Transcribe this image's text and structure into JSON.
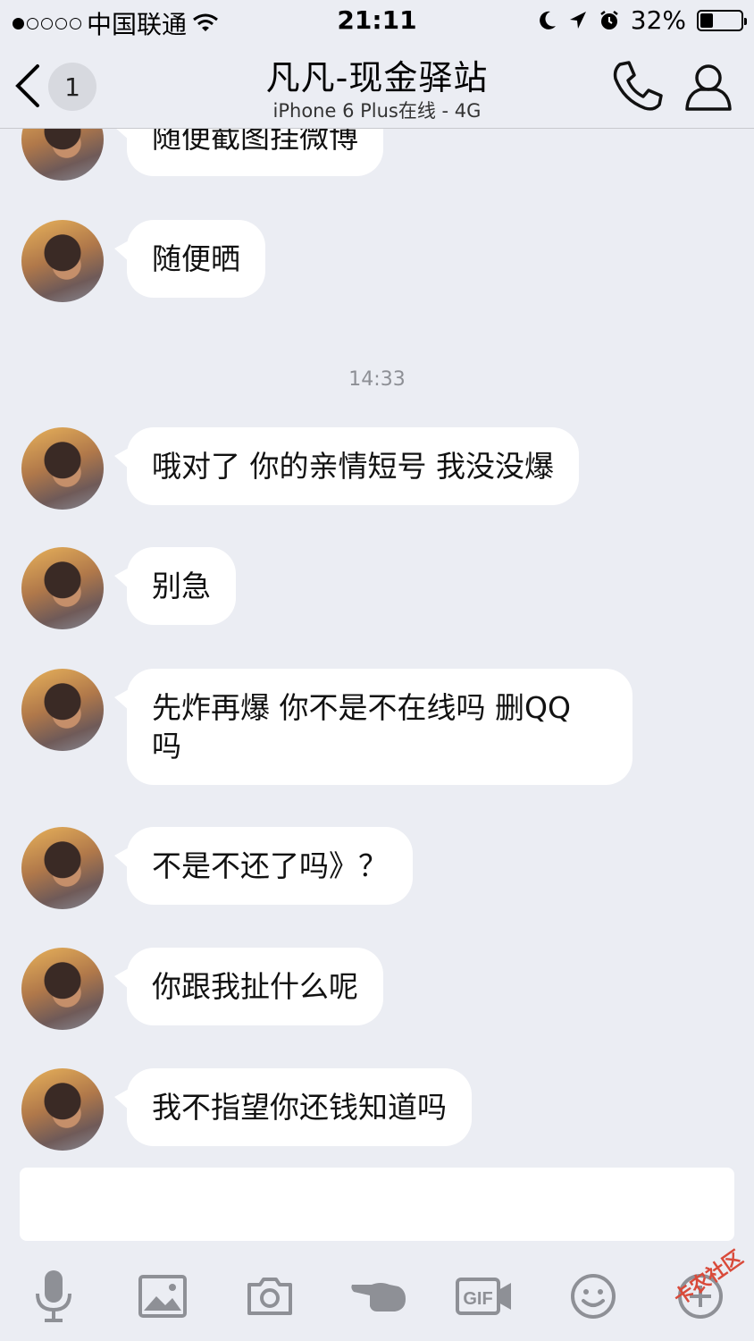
{
  "status_bar": {
    "carrier": "中国联通",
    "time": "21:11",
    "battery": "32%",
    "battery_level": 0.32
  },
  "nav": {
    "unread_count": "1",
    "title": "凡凡-现金驿站",
    "subtitle": "iPhone 6 Plus在线 - 4G"
  },
  "messages": [
    {
      "text": "随便截图挂微博"
    },
    {
      "text": "随便晒"
    },
    {
      "text": "哦对了 你的亲情短号 我没没爆"
    },
    {
      "text": "别急"
    },
    {
      "text": "先炸再爆 你不是不在线吗 删QQ\n吗"
    },
    {
      "text": "不是不还了吗》？"
    },
    {
      "text": "你跟我扯什么呢"
    },
    {
      "text": "我不指望你还钱知道吗"
    }
  ],
  "timestamp": "14:33",
  "toolbar": {
    "items": [
      "microphone-icon",
      "image-icon",
      "camera-icon",
      "poke-icon",
      "gif-icon",
      "emoji-icon",
      "plus-icon"
    ],
    "gif_label": "GIF"
  },
  "watermark": "卡农社区"
}
